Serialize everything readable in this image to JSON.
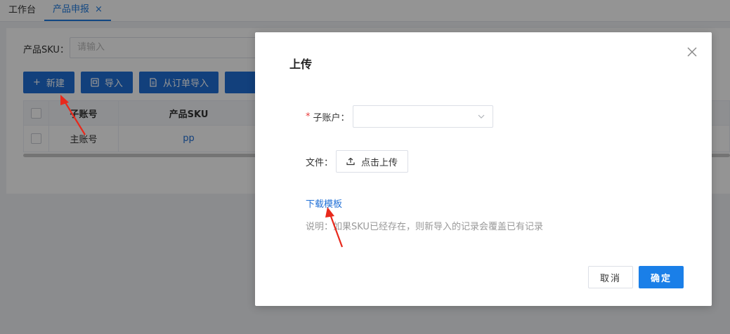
{
  "tabs": [
    {
      "label": "工作台"
    },
    {
      "label": "产品申报",
      "close": "×"
    }
  ],
  "filter": {
    "label": "产品SKU：",
    "placeholder": "请输入"
  },
  "toolbar": {
    "new_label": "新建",
    "new_icon": "+",
    "import_label": "导入",
    "import_from_order_label": "从订单导入"
  },
  "table": {
    "headers": [
      "子账号",
      "产品SKU"
    ],
    "rows": [
      [
        "主账号",
        "pp"
      ]
    ]
  },
  "dialog": {
    "title": "上传",
    "sub_account_label": "子账户：",
    "required_mark": "*",
    "file_label": "文件：",
    "upload_label": "点击上传",
    "download_template": "下载模板",
    "note": "说明：如果SKU已经存在，则新导入的记录会覆盖已有记录",
    "cancel_label": "取消",
    "ok_label": "确定"
  },
  "colors": {
    "primary": "#1f6fd6",
    "annotation_arrow": "#e8291c",
    "required": "#e83b3b"
  }
}
